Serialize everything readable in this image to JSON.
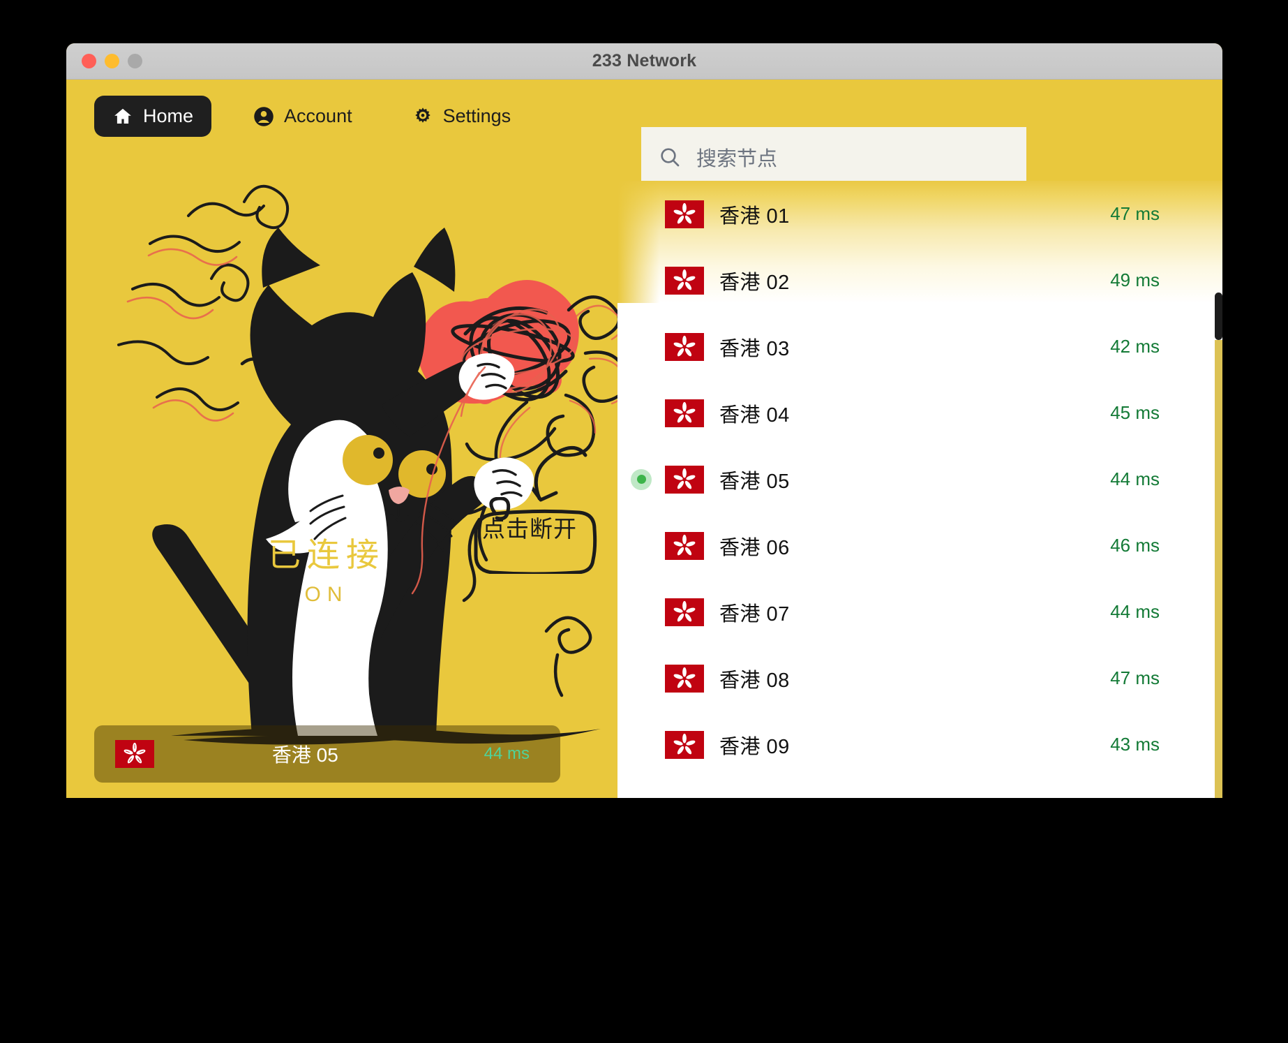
{
  "window": {
    "title": "233 Network",
    "traffic_lights": [
      "close-button",
      "minimize-button",
      "maximize-button"
    ]
  },
  "nav": {
    "items": [
      {
        "label": "Home",
        "icon": "home-icon",
        "active": true
      },
      {
        "label": "Account",
        "icon": "account-icon",
        "active": false
      },
      {
        "label": "Settings",
        "icon": "gear-icon",
        "active": false
      }
    ]
  },
  "connection": {
    "status_cn": "已连接",
    "status_en": "ON",
    "hint": "点击断开",
    "illustration": "cat-with-yarn-ball"
  },
  "selected_bar": {
    "flag": "hong-kong-flag",
    "name": "香港 05",
    "latency": "44 ms"
  },
  "search": {
    "placeholder": "搜索节点",
    "value": "",
    "icon": "search-icon"
  },
  "nodes": [
    {
      "flag": "hong-kong-flag",
      "name": "香港 01",
      "latency": "47 ms",
      "selected": false
    },
    {
      "flag": "hong-kong-flag",
      "name": "香港 02",
      "latency": "49 ms",
      "selected": false
    },
    {
      "flag": "hong-kong-flag",
      "name": "香港 03",
      "latency": "42 ms",
      "selected": false
    },
    {
      "flag": "hong-kong-flag",
      "name": "香港 04",
      "latency": "45 ms",
      "selected": false
    },
    {
      "flag": "hong-kong-flag",
      "name": "香港 05",
      "latency": "44 ms",
      "selected": true
    },
    {
      "flag": "hong-kong-flag",
      "name": "香港 06",
      "latency": "46 ms",
      "selected": false
    },
    {
      "flag": "hong-kong-flag",
      "name": "香港 07",
      "latency": "44 ms",
      "selected": false
    },
    {
      "flag": "hong-kong-flag",
      "name": "香港 08",
      "latency": "47 ms",
      "selected": false
    },
    {
      "flag": "hong-kong-flag",
      "name": "香港 09",
      "latency": "43 ms",
      "selected": false
    }
  ],
  "colors": {
    "brand_yellow": "#e9c83d",
    "titlebar_gray": "#c8c8c8",
    "nav_active_bg": "#1f1f1f",
    "latency_green": "#137a36",
    "selected_dot_green": "#3cb44a",
    "bar_latency_green": "#4fd39a",
    "flag_red": "#c00311",
    "search_bg": "#f4f3ec",
    "yarn_red": "#f2584f"
  }
}
